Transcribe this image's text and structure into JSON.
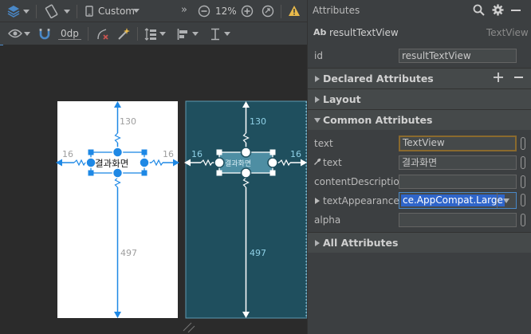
{
  "toolbar": {
    "device": "Custom",
    "zoom": "12%",
    "margin": "0dp"
  },
  "canvas": {
    "design_text": "결과화면",
    "blueprint_text": "결과화면",
    "margin_top": "130",
    "margin_bottom": "497",
    "margin_left": "16",
    "margin_right": "16",
    "blueprint_margin_top": "130",
    "blueprint_margin_bottom": "497",
    "blueprint_margin_left": "16",
    "blueprint_margin_right": "16"
  },
  "attributes": {
    "title": "Attributes",
    "component_icon": "Ab",
    "component_name": "resultTextView",
    "component_type": "TextView",
    "id_label": "id",
    "id_value": "resultTextView",
    "sections": {
      "declared": "Declared Attributes",
      "layout": "Layout",
      "common": "Common Attributes",
      "all": "All Attributes"
    },
    "common_rows": [
      {
        "label": "text",
        "value": "TextView"
      },
      {
        "label": "text",
        "value": "결과화면"
      },
      {
        "label": "contentDescription",
        "value": ""
      },
      {
        "label": "textAppearance",
        "value": "ce.AppCompat.Large"
      },
      {
        "label": "alpha",
        "value": ""
      }
    ]
  },
  "colors": {
    "accent": "#4a88c7",
    "constraint": "#1e88e5",
    "blueprint_bg": "#1f4f5e",
    "warning": "#e8b94a"
  },
  "icons": [
    "layers-icon",
    "orientation-icon",
    "device-icon",
    "overflow-icon",
    "zoom-out-icon",
    "zoom-in-icon",
    "zoom-fit-icon",
    "warning-icon",
    "eye-icon",
    "magnet-icon",
    "clear-constraints-icon",
    "infer-constraints-icon",
    "pack-icon",
    "align-icon",
    "guidelines-icon",
    "search-icon",
    "gear-icon",
    "minimize-icon",
    "add-icon",
    "remove-icon",
    "wrench-icon",
    "dropdown-icon",
    "attribute-picker-icon"
  ]
}
